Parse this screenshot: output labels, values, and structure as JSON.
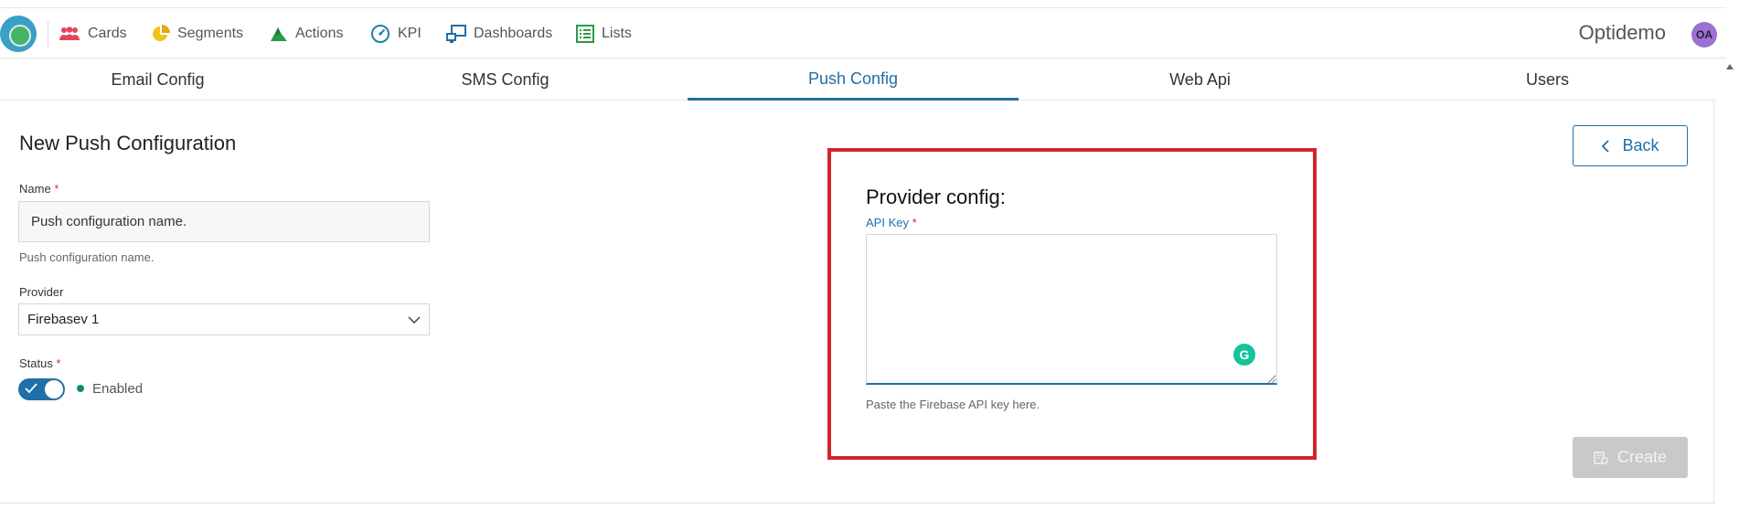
{
  "nav": {
    "items": [
      {
        "label": "Cards",
        "icon": "users-icon"
      },
      {
        "label": "Segments",
        "icon": "pie-chart-icon"
      },
      {
        "label": "Actions",
        "icon": "actions-icon"
      },
      {
        "label": "KPI",
        "icon": "gauge-icon"
      },
      {
        "label": "Dashboards",
        "icon": "dashboard-icon"
      },
      {
        "label": "Lists",
        "icon": "list-icon"
      }
    ],
    "brand": "Optidemo",
    "avatar_initials": "OA"
  },
  "tabs": [
    {
      "label": "Email Config",
      "active": false
    },
    {
      "label": "SMS Config",
      "active": false
    },
    {
      "label": "Push Config",
      "active": true
    },
    {
      "label": "Web Api",
      "active": false
    },
    {
      "label": "Users",
      "active": false
    }
  ],
  "form": {
    "title": "New Push Configuration",
    "name_label": "Name",
    "name_value": "Push configuration name.",
    "name_hint": "Push configuration name.",
    "provider_label": "Provider",
    "provider_value": "Firebasev 1",
    "status_label": "Status",
    "status_value": "Enabled",
    "required_mark": "*"
  },
  "provider_config": {
    "title": "Provider config:",
    "api_key_label": "API Key",
    "api_key_value": "",
    "api_key_hint": "Paste the Firebase API key here.",
    "grammarly_glyph": "G"
  },
  "actions": {
    "back_label": "Back",
    "create_label": "Create"
  },
  "colors": {
    "accent": "#1f6fa8",
    "highlight": "#d4232d",
    "status_dot": "#138a6f"
  }
}
